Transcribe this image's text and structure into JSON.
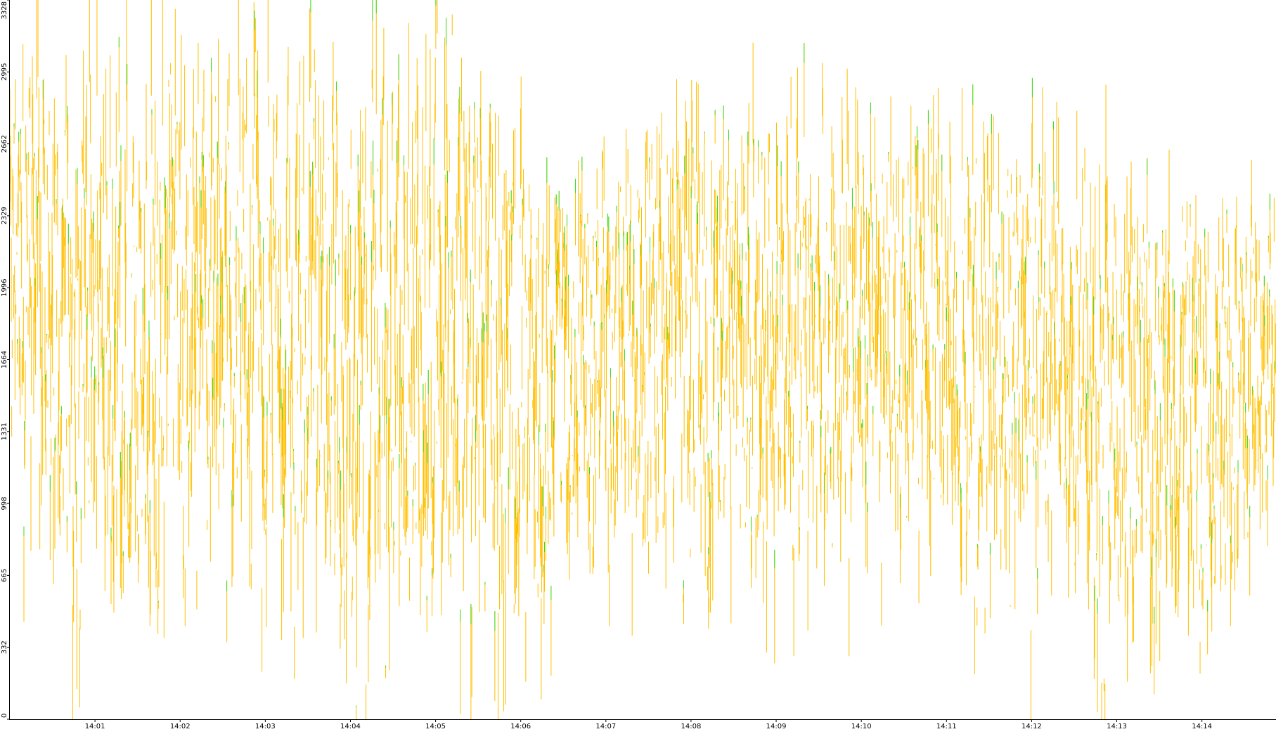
{
  "chart_data": {
    "type": "bar",
    "title": "",
    "xlabel": "",
    "ylabel": "",
    "ylim": [
      0,
      3328
    ],
    "yticks": [
      "0",
      "332",
      "665",
      "998",
      "1331",
      "1664",
      "1996",
      "2329",
      "2662",
      "2995",
      "3328"
    ],
    "xlim_minutes": [
      0.0,
      14.87
    ],
    "xticks": [
      "14:01",
      "14:02",
      "14:03",
      "14:04",
      "14:05",
      "14:06",
      "14:07",
      "14:08",
      "14:09",
      "14:10",
      "14:11",
      "14:12",
      "14:13",
      "14:14"
    ],
    "grid": false,
    "legend": "none",
    "colors": {
      "primary": "#ffbf00",
      "secondary": "#33dd22",
      "axis": "#000000",
      "background": "#ffffff"
    },
    "series": [
      {
        "color": "#ffbf00",
        "mean_profile_minute": [
          0,
          1,
          2,
          3,
          4,
          5,
          6,
          7,
          8,
          9,
          10,
          11,
          12,
          13,
          14,
          14.87
        ],
        "mean_profile_value": [
          2150,
          1700,
          1900,
          2000,
          1700,
          1750,
          1600,
          1650,
          1700,
          1600,
          1950,
          1650,
          1800,
          1500,
          1250,
          1750
        ],
        "peak_envelope_value": [
          3000,
          2950,
          3000,
          2950,
          2900,
          3300,
          2750,
          2650,
          2700,
          2750,
          2830,
          2600,
          2400,
          2320,
          2300,
          2250
        ],
        "trough_envelope_value": [
          900,
          300,
          400,
          600,
          0,
          350,
          450,
          600,
          400,
          650,
          700,
          500,
          400,
          100,
          200,
          700
        ]
      },
      {
        "color": "#33dd22",
        "share_of_bar": 0.08
      }
    ]
  }
}
